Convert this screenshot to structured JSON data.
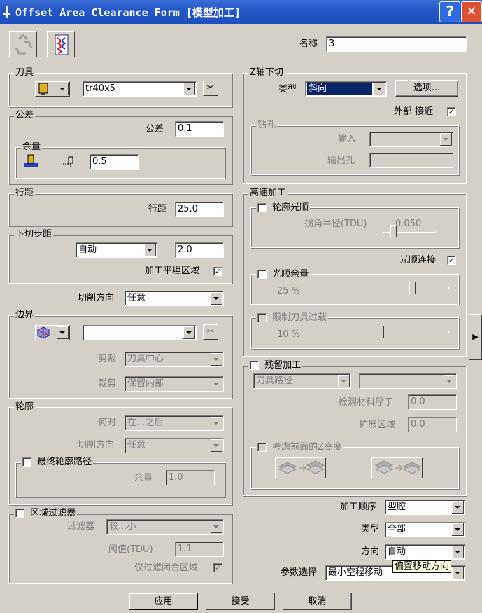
{
  "window": {
    "title": "Offset Area Clearance Form [模型加工]",
    "help_label": "?",
    "close_label": "✕"
  },
  "name_label": "名称",
  "name_value": "3",
  "tool": {
    "group": "刀具",
    "value": "tr40x5"
  },
  "tolerance": {
    "group": "公差",
    "tol_label": "公差",
    "tol_value": "0.1",
    "allow_group": "余量",
    "allow_value": "0.5"
  },
  "stepover": {
    "group": "行距",
    "label": "行距",
    "value": "25.0"
  },
  "stepdown": {
    "group": "下切步距",
    "mode": "自动",
    "value": "2.0",
    "flat_label": "加工平坦区域",
    "flat_checked": "✓"
  },
  "cut_direction": {
    "label": "切削方向",
    "value": "任意"
  },
  "boundary": {
    "group": "边界",
    "value": "",
    "trim_label": "剪裁",
    "trim_value": "刀具中心",
    "keep_label": "裁剪",
    "keep_value": "保留内部"
  },
  "profile": {
    "group": "轮廓",
    "when_label": "何时",
    "when_value": "在...之后",
    "dir_label": "切削方向",
    "dir_value": "任意",
    "final_label": "最终轮廓路径",
    "allow_label": "余量",
    "allow_value": "1.0"
  },
  "region_filter": {
    "label": "区域过滤器",
    "filter_label": "过滤器",
    "filter_value": "较...小",
    "thresh_label": "阈值(TDU)",
    "thresh_value": "1.1",
    "closed_label": "仅过滤闭合区域",
    "closed_checked": "✓"
  },
  "zplunge": {
    "group": "Z轴下切",
    "type_label": "类型",
    "type_value": "斜向",
    "options_label": "选项...",
    "external_label": "外部 接近",
    "external_checked": "✓",
    "drill_group": "钻孔",
    "in_label": "输入",
    "out_label": "输出孔"
  },
  "hsm": {
    "group": "高速加工",
    "profile_smooth": "轮廓光顺",
    "corner_label": "拐角半径(TDU)",
    "corner_value": "0.050",
    "smooth_link_label": "光顺连接",
    "smooth_link_checked": "✓",
    "smooth_allow": "光顺余量",
    "smooth_allow_pct": "25 %",
    "smooth_allow_level": 0.55,
    "limit_label": "限制刀具过载",
    "limit_pct": "10 %",
    "limit_level": 0.12,
    "corner_level": 0.15
  },
  "rest": {
    "label": "残留加工",
    "mode_value": "刀具路径",
    "detect_label": "检测材料厚于",
    "detect_value": "0.0",
    "expand_label": "扩展区域",
    "expand_value": "0.0",
    "consider_label": "考虑前面的Z高度"
  },
  "order": {
    "label": "加工顺序",
    "value": "型腔"
  },
  "type2": {
    "label": "类型",
    "value": "全部"
  },
  "direction": {
    "label": "方向",
    "value": "自动"
  },
  "param": {
    "label": "参数选择",
    "value": "最小空程移动",
    "tooltip": "偏置移动方向"
  },
  "buttons": {
    "apply": "应用",
    "accept": "接受",
    "cancel": "取消"
  },
  "expand_arrow": "▶"
}
